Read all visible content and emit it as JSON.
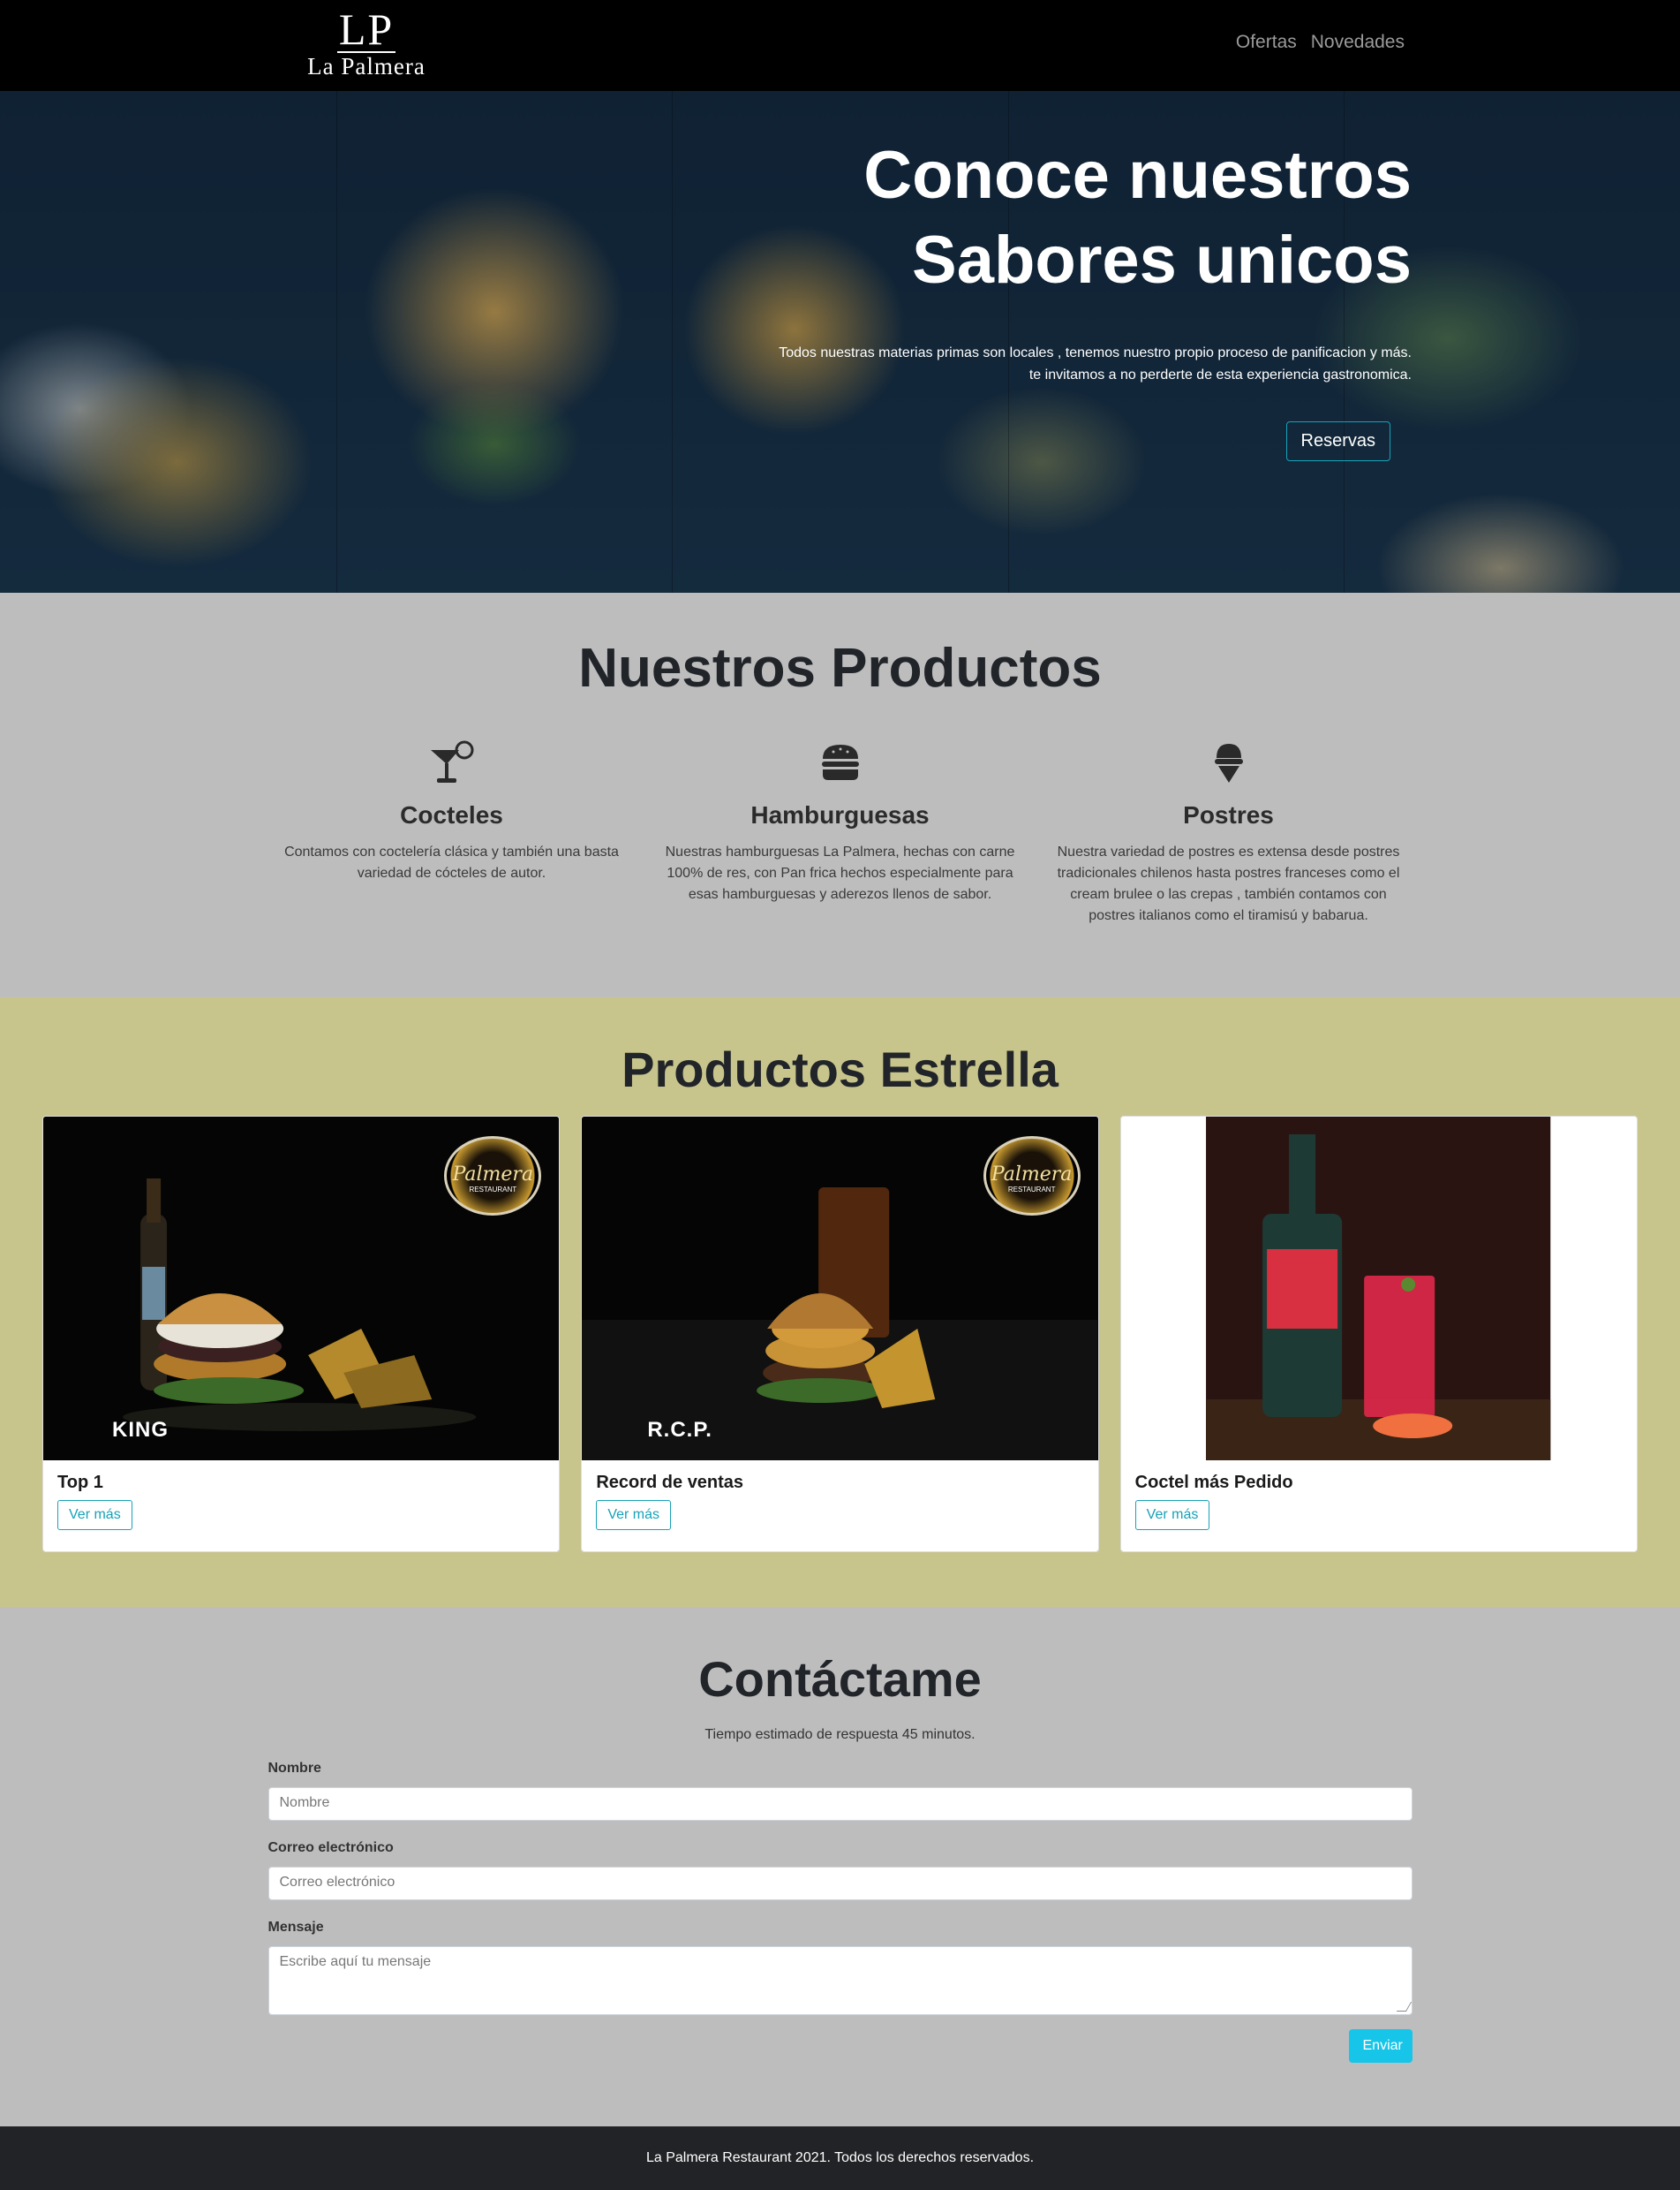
{
  "brand": {
    "mono": "LP",
    "name": "La Palmera"
  },
  "nav": {
    "items": [
      "Ofertas",
      "Novedades"
    ]
  },
  "hero": {
    "title_line1": "Conoce nuestros",
    "title_line2": "Sabores unicos",
    "text_line1": "Todos nuestras materias primas son locales , tenemos nuestro propio proceso de panificacion y más.",
    "text_line2": "te invitamos a no perderte de esta experiencia gastronomica.",
    "button": "Reservas"
  },
  "products": {
    "title": "Nuestros Productos",
    "items": [
      {
        "icon": "cocktail-icon",
        "title": "Cocteles",
        "text": "Contamos con coctelería clásica y también una basta variedad de cócteles de autor."
      },
      {
        "icon": "hamburger-icon",
        "title": "Hamburguesas",
        "text": "Nuestras hamburguesas La Palmera, hechas con carne 100% de res, con Pan frica hechos especialmente para esas hamburguesas y aderezos llenos de sabor."
      },
      {
        "icon": "ice-cream-icon",
        "title": "Postres",
        "text": "Nuestra variedad de postres es extensa desde postres tradicionales chilenos hasta postres franceses como el cream brulee o las crepas , también contamos con postres italianos como el tiramisú y babarua."
      }
    ]
  },
  "stars": {
    "title": "Productos Estrella",
    "cards": [
      {
        "title": "Top 1",
        "button": "Ver más",
        "label": "KING"
      },
      {
        "title": "Record de ventas",
        "button": "Ver más",
        "label": "R.C.P."
      },
      {
        "title": "Coctel más Pedido",
        "button": "Ver más"
      }
    ],
    "logo_word": "Palmera",
    "logo_sub": "RESTAURANT"
  },
  "contact": {
    "title": "Contáctame",
    "subtitle": "Tiempo estimado de respuesta 45 minutos.",
    "fields": [
      {
        "label": "Nombre",
        "placeholder": "Nombre"
      },
      {
        "label": "Correo electrónico",
        "placeholder": "Correo electrónico"
      },
      {
        "label": "Mensaje",
        "placeholder": "Escribe aquí tu mensaje"
      }
    ],
    "submit": "Enviar"
  },
  "footer": {
    "text": "La Palmera Restaurant 2021. Todos los derechos reservados."
  }
}
